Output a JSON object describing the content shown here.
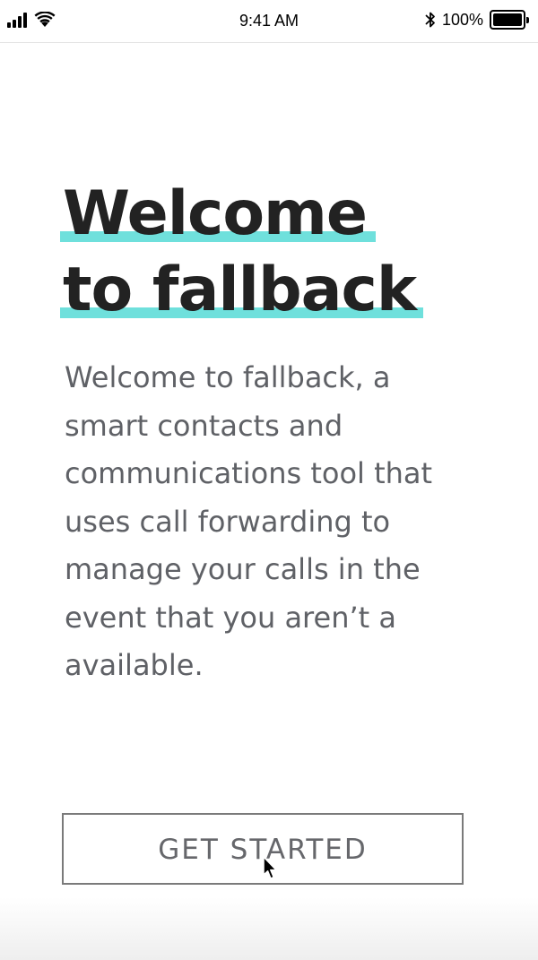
{
  "status_bar": {
    "time": "9:41 AM",
    "battery_percent": "100%",
    "icons": {
      "signal": "signal-bars-icon",
      "wifi": "wifi-icon",
      "bluetooth": "bluetooth-icon",
      "battery": "battery-icon"
    }
  },
  "welcome": {
    "title_line_1": "Welcome",
    "title_line_2": "to fallback",
    "description": "Welcome to fallback, a smart contacts and communications tool that uses call forwarding to manage your calls in the event that you aren’t a available."
  },
  "actions": {
    "get_started_label": "GET STARTED"
  },
  "colors": {
    "highlight": "#6fe0dc",
    "title_text": "#222222",
    "body_text": "#5f6166",
    "button_border": "#7a7a7a",
    "button_text": "#66676b"
  }
}
